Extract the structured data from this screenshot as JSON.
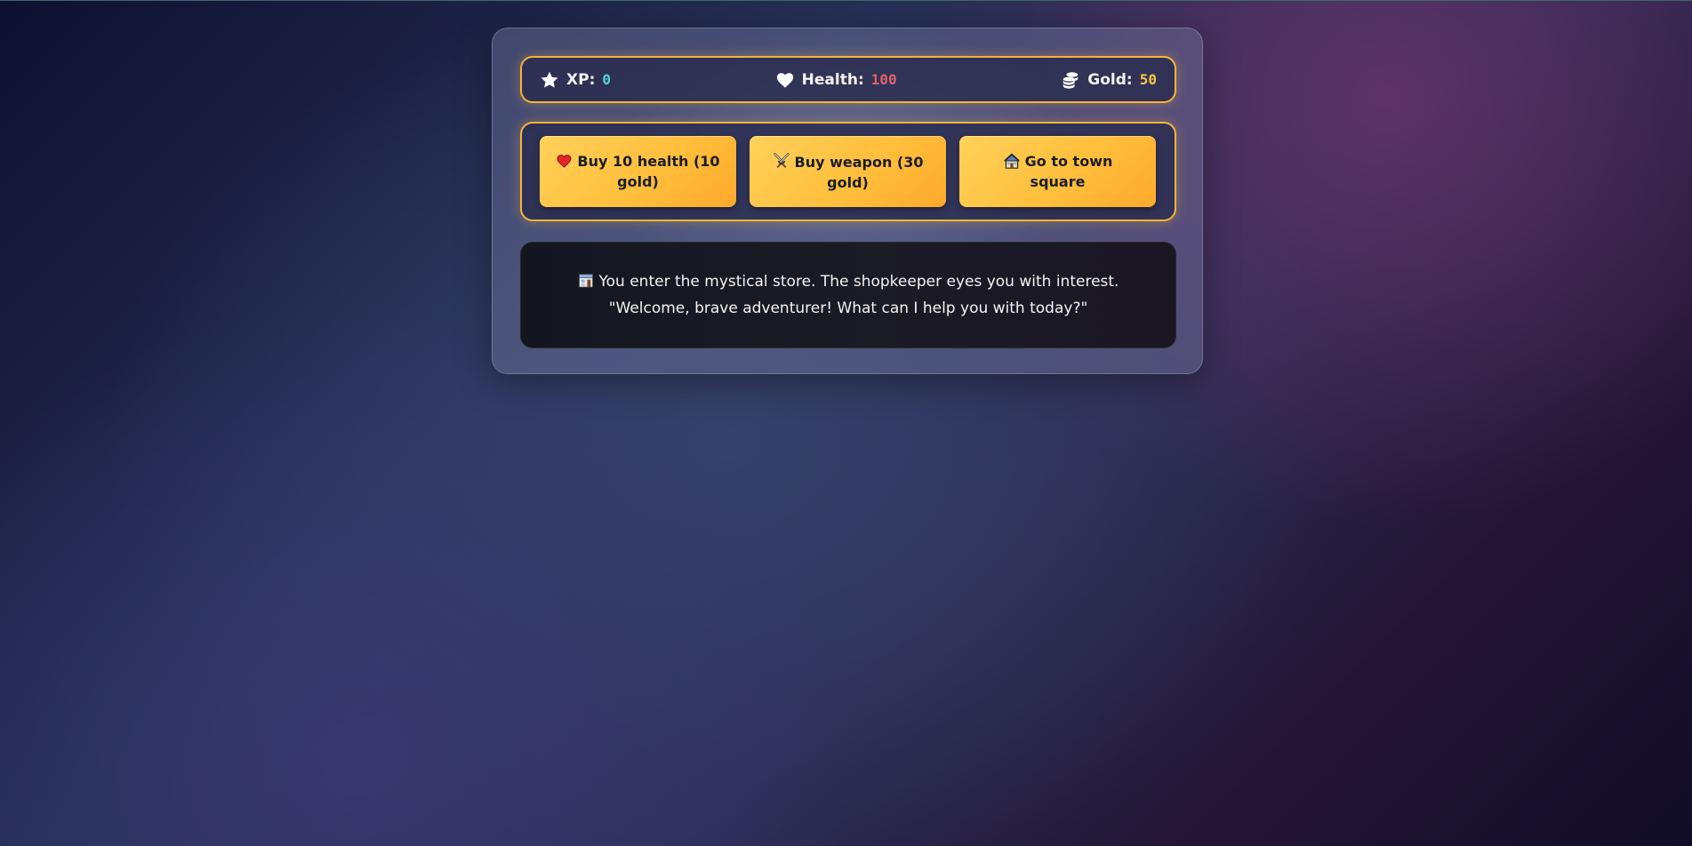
{
  "stats": {
    "xp_label": "XP:",
    "xp_value": "0",
    "health_label": "Health:",
    "health_value": "100",
    "gold_label": "Gold:",
    "gold_value": "50",
    "xp_icon": "star-icon",
    "health_icon": "heart-icon",
    "gold_icon": "coins-icon"
  },
  "controls": {
    "button1": {
      "label": "Buy 10 health (10 gold)",
      "icon": "red-heart-icon"
    },
    "button2": {
      "label": "Buy weapon (30 gold)",
      "icon": "crossed-swords-icon"
    },
    "button3": {
      "label": "Go to town square",
      "icon": "house-icon"
    }
  },
  "text": {
    "icon": "store-icon",
    "message": "You enter the mystical store. The shopkeeper eyes you with interest. \"Welcome, brave adventurer! What can I help you with today?\""
  },
  "colors": {
    "accent_border": "#f5b33b",
    "button_gradient_start": "#ffd15a",
    "button_gradient_end": "#ffaa2c",
    "xp_color": "#4fd6cf",
    "health_color": "#e0606a",
    "gold_color": "#f5c842"
  }
}
